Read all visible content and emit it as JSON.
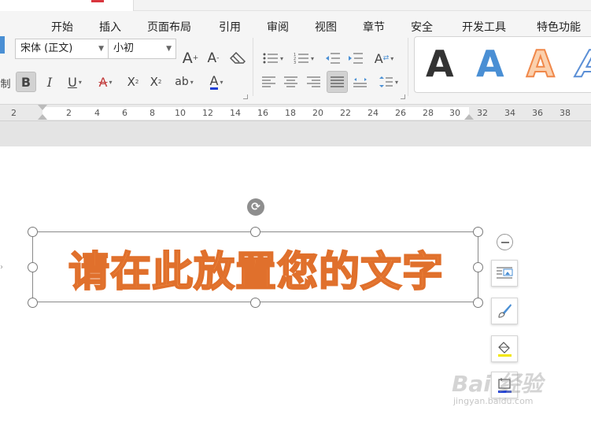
{
  "ribbon": {
    "menu": [
      "开始",
      "插入",
      "页面布局",
      "引用",
      "审阅",
      "视图",
      "章节",
      "安全",
      "开发工具",
      "特色功能"
    ],
    "font": {
      "family": "宋体 (正文)",
      "size": "小初"
    },
    "left_cut_label": "制"
  },
  "style_gallery": {
    "items": [
      {
        "letter": "A",
        "color": "#000000"
      },
      {
        "letter": "A",
        "color": "#4a8fd4"
      },
      {
        "letter": "A",
        "color": "#f0884a"
      },
      {
        "letter": "A",
        "color": "#5b8fd6"
      }
    ]
  },
  "ruler": {
    "labels": [
      "2",
      "2",
      "4",
      "6",
      "8",
      "10",
      "12",
      "14",
      "16",
      "18",
      "20",
      "22",
      "24",
      "26",
      "28",
      "30",
      "32",
      "34",
      "36",
      "38"
    ]
  },
  "document": {
    "wordart_text": "请在此放置您的文字"
  },
  "watermark": {
    "text": "Bai 经验",
    "sub": "jingyan.baidu.com"
  },
  "colors": {
    "wordart_fill": "#f29148",
    "wordart_stroke": "#e0702c",
    "highlight": "#f2e600",
    "underline_blue": "#1f3fd6"
  }
}
